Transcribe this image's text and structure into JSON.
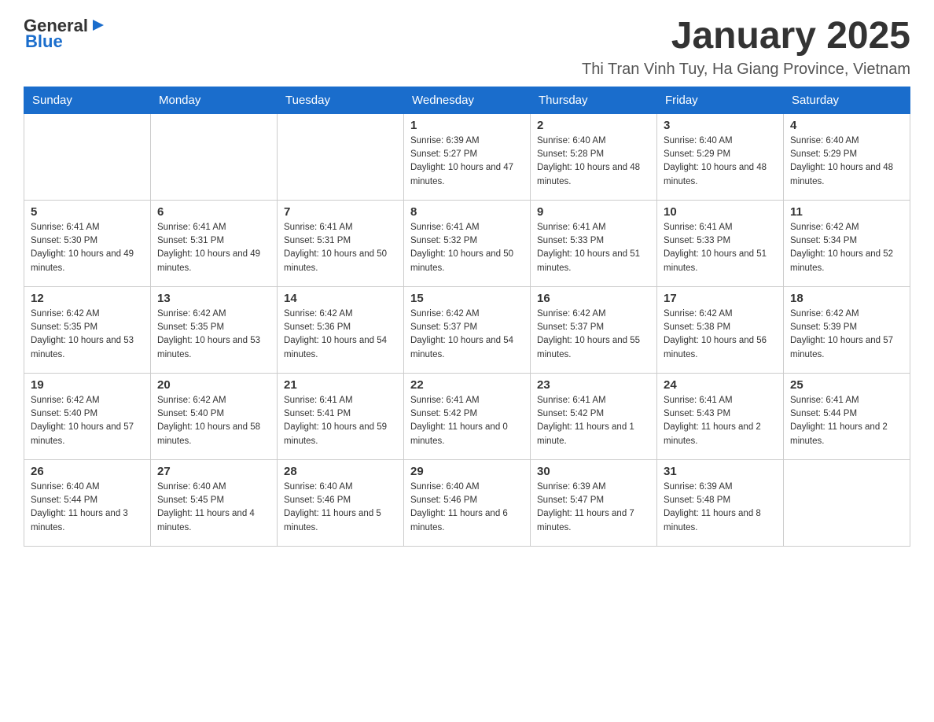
{
  "header": {
    "logo_general": "General",
    "logo_blue": "Blue",
    "main_title": "January 2025",
    "subtitle": "Thi Tran Vinh Tuy, Ha Giang Province, Vietnam"
  },
  "days_of_week": [
    "Sunday",
    "Monday",
    "Tuesday",
    "Wednesday",
    "Thursday",
    "Friday",
    "Saturday"
  ],
  "weeks": [
    [
      {
        "day": "",
        "info": ""
      },
      {
        "day": "",
        "info": ""
      },
      {
        "day": "",
        "info": ""
      },
      {
        "day": "1",
        "info": "Sunrise: 6:39 AM\nSunset: 5:27 PM\nDaylight: 10 hours and 47 minutes."
      },
      {
        "day": "2",
        "info": "Sunrise: 6:40 AM\nSunset: 5:28 PM\nDaylight: 10 hours and 48 minutes."
      },
      {
        "day": "3",
        "info": "Sunrise: 6:40 AM\nSunset: 5:29 PM\nDaylight: 10 hours and 48 minutes."
      },
      {
        "day": "4",
        "info": "Sunrise: 6:40 AM\nSunset: 5:29 PM\nDaylight: 10 hours and 48 minutes."
      }
    ],
    [
      {
        "day": "5",
        "info": "Sunrise: 6:41 AM\nSunset: 5:30 PM\nDaylight: 10 hours and 49 minutes."
      },
      {
        "day": "6",
        "info": "Sunrise: 6:41 AM\nSunset: 5:31 PM\nDaylight: 10 hours and 49 minutes."
      },
      {
        "day": "7",
        "info": "Sunrise: 6:41 AM\nSunset: 5:31 PM\nDaylight: 10 hours and 50 minutes."
      },
      {
        "day": "8",
        "info": "Sunrise: 6:41 AM\nSunset: 5:32 PM\nDaylight: 10 hours and 50 minutes."
      },
      {
        "day": "9",
        "info": "Sunrise: 6:41 AM\nSunset: 5:33 PM\nDaylight: 10 hours and 51 minutes."
      },
      {
        "day": "10",
        "info": "Sunrise: 6:41 AM\nSunset: 5:33 PM\nDaylight: 10 hours and 51 minutes."
      },
      {
        "day": "11",
        "info": "Sunrise: 6:42 AM\nSunset: 5:34 PM\nDaylight: 10 hours and 52 minutes."
      }
    ],
    [
      {
        "day": "12",
        "info": "Sunrise: 6:42 AM\nSunset: 5:35 PM\nDaylight: 10 hours and 53 minutes."
      },
      {
        "day": "13",
        "info": "Sunrise: 6:42 AM\nSunset: 5:35 PM\nDaylight: 10 hours and 53 minutes."
      },
      {
        "day": "14",
        "info": "Sunrise: 6:42 AM\nSunset: 5:36 PM\nDaylight: 10 hours and 54 minutes."
      },
      {
        "day": "15",
        "info": "Sunrise: 6:42 AM\nSunset: 5:37 PM\nDaylight: 10 hours and 54 minutes."
      },
      {
        "day": "16",
        "info": "Sunrise: 6:42 AM\nSunset: 5:37 PM\nDaylight: 10 hours and 55 minutes."
      },
      {
        "day": "17",
        "info": "Sunrise: 6:42 AM\nSunset: 5:38 PM\nDaylight: 10 hours and 56 minutes."
      },
      {
        "day": "18",
        "info": "Sunrise: 6:42 AM\nSunset: 5:39 PM\nDaylight: 10 hours and 57 minutes."
      }
    ],
    [
      {
        "day": "19",
        "info": "Sunrise: 6:42 AM\nSunset: 5:40 PM\nDaylight: 10 hours and 57 minutes."
      },
      {
        "day": "20",
        "info": "Sunrise: 6:42 AM\nSunset: 5:40 PM\nDaylight: 10 hours and 58 minutes."
      },
      {
        "day": "21",
        "info": "Sunrise: 6:41 AM\nSunset: 5:41 PM\nDaylight: 10 hours and 59 minutes."
      },
      {
        "day": "22",
        "info": "Sunrise: 6:41 AM\nSunset: 5:42 PM\nDaylight: 11 hours and 0 minutes."
      },
      {
        "day": "23",
        "info": "Sunrise: 6:41 AM\nSunset: 5:42 PM\nDaylight: 11 hours and 1 minute."
      },
      {
        "day": "24",
        "info": "Sunrise: 6:41 AM\nSunset: 5:43 PM\nDaylight: 11 hours and 2 minutes."
      },
      {
        "day": "25",
        "info": "Sunrise: 6:41 AM\nSunset: 5:44 PM\nDaylight: 11 hours and 2 minutes."
      }
    ],
    [
      {
        "day": "26",
        "info": "Sunrise: 6:40 AM\nSunset: 5:44 PM\nDaylight: 11 hours and 3 minutes."
      },
      {
        "day": "27",
        "info": "Sunrise: 6:40 AM\nSunset: 5:45 PM\nDaylight: 11 hours and 4 minutes."
      },
      {
        "day": "28",
        "info": "Sunrise: 6:40 AM\nSunset: 5:46 PM\nDaylight: 11 hours and 5 minutes."
      },
      {
        "day": "29",
        "info": "Sunrise: 6:40 AM\nSunset: 5:46 PM\nDaylight: 11 hours and 6 minutes."
      },
      {
        "day": "30",
        "info": "Sunrise: 6:39 AM\nSunset: 5:47 PM\nDaylight: 11 hours and 7 minutes."
      },
      {
        "day": "31",
        "info": "Sunrise: 6:39 AM\nSunset: 5:48 PM\nDaylight: 11 hours and 8 minutes."
      },
      {
        "day": "",
        "info": ""
      }
    ]
  ]
}
